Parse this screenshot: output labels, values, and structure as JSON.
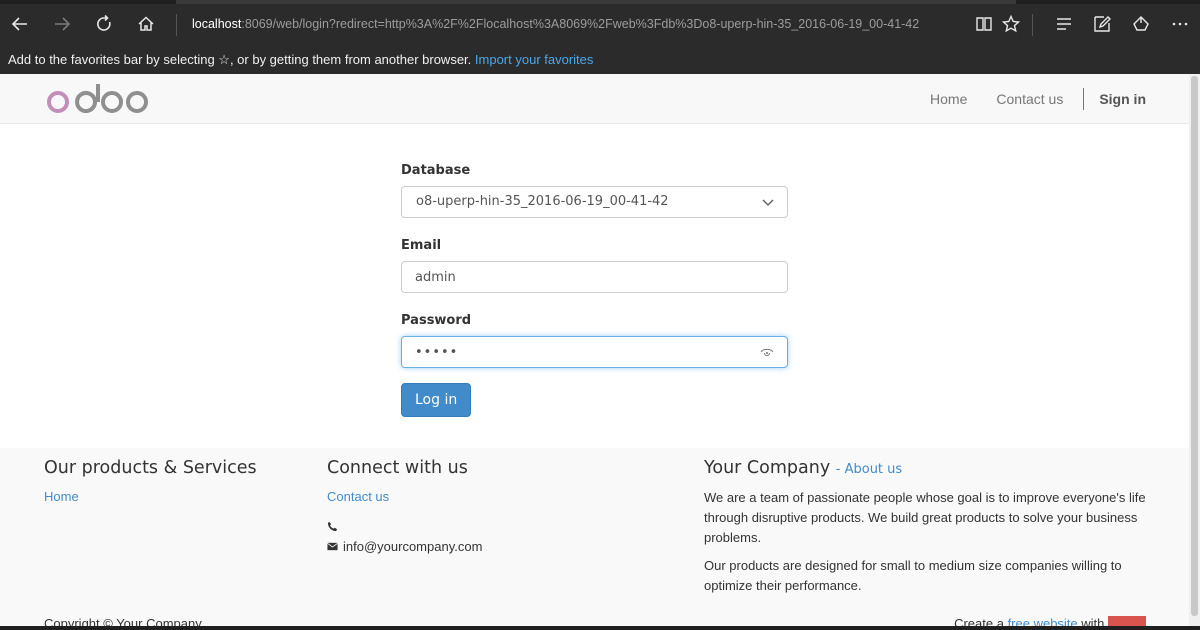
{
  "browser": {
    "address_host": "localhost",
    "address_rest": ":8069/web/login?redirect=http%3A%2F%2Flocalhost%3A8069%2Fweb%3Fdb%3Do8-uperp-hin-35_2016-06-19_00-41-42",
    "favbar_text": "Add to the favorites bar by selecting ☆, or by getting them from another browser.",
    "favbar_link": "Import your favorites"
  },
  "header": {
    "logo_text": "odoo",
    "menu": {
      "home": "Home",
      "contact": "Contact us",
      "signin": "Sign in"
    }
  },
  "login": {
    "database_label": "Database",
    "database_value": "o8-uperp-hin-35_2016-06-19_00-41-42",
    "email_label": "Email",
    "email_value": "admin",
    "password_label": "Password",
    "password_value": "•••••",
    "submit_label": "Log in"
  },
  "footer": {
    "products": {
      "title": "Our products & Services",
      "link_home": "Home"
    },
    "connect": {
      "title": "Connect with us",
      "link_contact": "Contact us",
      "email": "info@yourcompany.com"
    },
    "company": {
      "title": "Your Company",
      "about_link": "- About us",
      "para1": "We are a team of passionate people whose goal is to improve everyone's life through disruptive products. We build great products to solve your business problems.",
      "para2": "Our products are designed for small to medium size companies willing to optimize their performance."
    },
    "copyright": "Copyright © Your Company",
    "create_prefix": "Create a ",
    "create_link": "free website",
    "create_suffix": " with "
  },
  "colors": {
    "brand_primary": "#428bca",
    "odoo_logo": "#875a7b",
    "browser_chrome": "#2b2b2b"
  }
}
